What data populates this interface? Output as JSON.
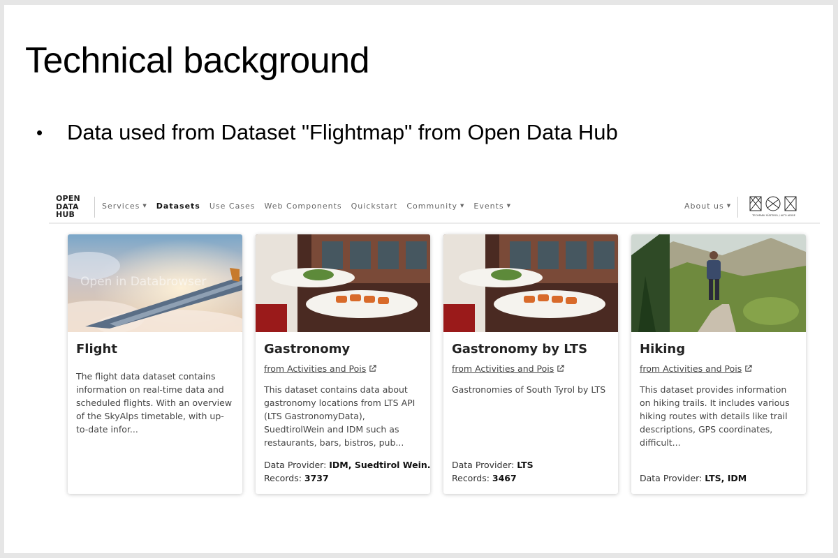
{
  "slide": {
    "title": "Technical background",
    "bullet": "Data used from Dataset \"Flightmap\" from Open Data Hub"
  },
  "nav": {
    "logo": [
      "OPEN",
      "DATA",
      "HUB"
    ],
    "items": [
      {
        "label": "Services",
        "dropdown": true,
        "active": false
      },
      {
        "label": "Datasets",
        "dropdown": false,
        "active": true
      },
      {
        "label": "Use Cases",
        "dropdown": false,
        "active": false
      },
      {
        "label": "Web Components",
        "dropdown": false,
        "active": false
      },
      {
        "label": "Quickstart",
        "dropdown": false,
        "active": false
      },
      {
        "label": "Community",
        "dropdown": true,
        "active": false
      },
      {
        "label": "Events",
        "dropdown": true,
        "active": false
      }
    ],
    "about": "About us",
    "partner_logo_text": "TECHPARK SÜDTIROL / ALTO ADIGE"
  },
  "cards": [
    {
      "title": "Flight",
      "image_overlay": "Open in Databrowser",
      "link": "",
      "description": "The flight data dataset contains information on real-time data and scheduled flights. With an overview of the SkyAlps timetable, with up-to-date infor...",
      "provider_label": "",
      "provider": "",
      "records_label": "",
      "records": ""
    },
    {
      "title": "Gastronomy",
      "link": "from Activities and Pois",
      "description": "This dataset contains data about gastronomy locations from LTS API (LTS GastronomyData), SuedtirolWein and IDM such as restaurants, bars, bistros, pub...",
      "provider_label": "Data Provider: ",
      "provider": "IDM, Suedtirol Wein...",
      "records_label": "Records: ",
      "records": "3737"
    },
    {
      "title": "Gastronomy by LTS",
      "link": "from Activities and Pois",
      "description": "Gastronomies of South Tyrol by LTS",
      "provider_label": "Data Provider: ",
      "provider": "LTS",
      "records_label": "Records: ",
      "records": "3467"
    },
    {
      "title": "Hiking",
      "link": "from Activities and Pois",
      "description": "This dataset provides information on hiking trails. It includes various hiking routes with details like trail descriptions, GPS coordinates, difficult...",
      "provider_label": "Data Provider: ",
      "provider": "LTS, IDM",
      "records_label": "",
      "records": ""
    }
  ],
  "colors": {
    "background": "#e6e6e6",
    "slide": "#ffffff",
    "text_dark": "#222222",
    "text_muted": "#666666"
  }
}
